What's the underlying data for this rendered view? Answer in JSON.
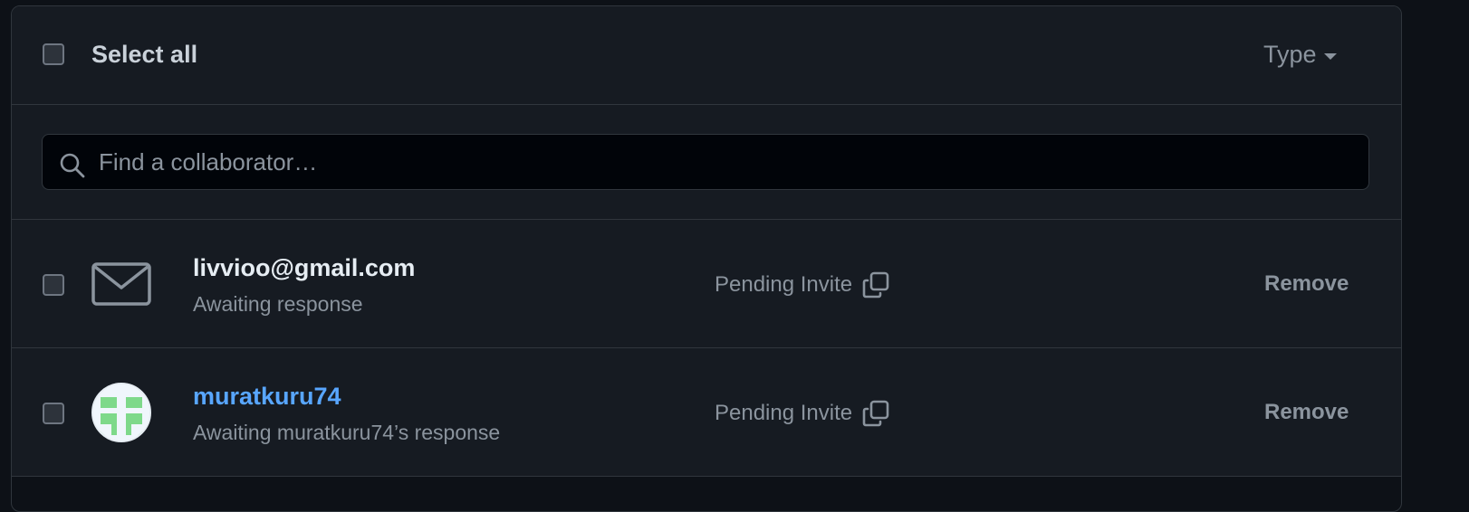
{
  "header": {
    "select_all_label": "Select all",
    "type_filter_label": "Type"
  },
  "search": {
    "placeholder": "Find a collaborator…",
    "value": ""
  },
  "collaborators": [
    {
      "name": "livvioo@gmail.com",
      "subtitle": "Awaiting response",
      "status": "Pending Invite",
      "action": "Remove",
      "avatar_icon": "mail-icon"
    },
    {
      "name": "muratkuru74",
      "subtitle": "Awaiting muratkuru74’s response",
      "status": "Pending Invite",
      "action": "Remove",
      "avatar_icon": "identicon-avatar"
    }
  ],
  "colors": {
    "background": "#0d1117",
    "panel": "#161b22",
    "border": "#30363d",
    "link": "#58a6ff",
    "muted": "#8b949e",
    "identicon": "#7ed98a"
  }
}
